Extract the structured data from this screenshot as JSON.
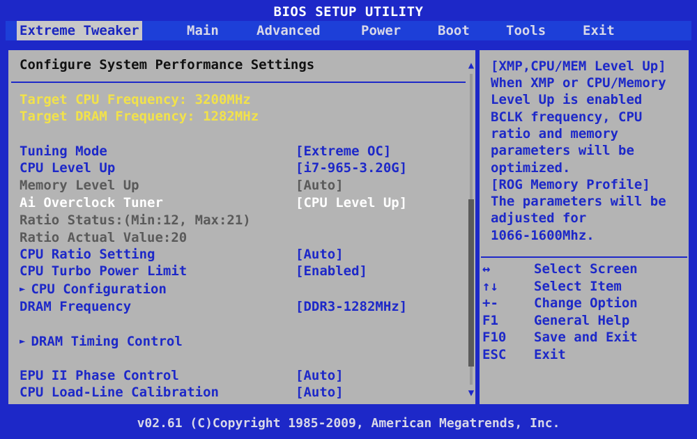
{
  "title": "BIOS SETUP UTILITY",
  "tabs": [
    {
      "label": "Extreme Tweaker",
      "active": true
    },
    {
      "label": "Main"
    },
    {
      "label": "Advanced"
    },
    {
      "label": "Power"
    },
    {
      "label": "Boot"
    },
    {
      "label": "Tools"
    },
    {
      "label": "Exit"
    }
  ],
  "main": {
    "section_title": "Configure System Performance Settings",
    "targets": [
      "Target CPU Frequency: 3200MHz",
      "Target DRAM Frequency: 1282MHz"
    ],
    "items": [
      {
        "label": "Tuning Mode",
        "value": "[Extreme OC]"
      },
      {
        "label": "CPU Level Up",
        "value": "[i7-965-3.20G]"
      },
      {
        "label": "Memory Level Up",
        "value": "[Auto]"
      },
      {
        "label": "Ai Overclock Tuner",
        "value": "[CPU Level Up]"
      },
      {
        "label": "Ratio Status:(Min:12, Max:21)",
        "value": ""
      },
      {
        "label": "Ratio Actual Value:20",
        "value": ""
      },
      {
        "label": "CPU Ratio Setting",
        "value": "[Auto]"
      },
      {
        "label": "CPU Turbo Power Limit",
        "value": "[Enabled]"
      },
      {
        "label": "CPU Configuration",
        "value": ""
      },
      {
        "label": "DRAM Frequency",
        "value": "[DDR3-1282MHz]"
      },
      {
        "label": "DRAM Timing Control",
        "value": ""
      },
      {
        "label": "EPU II Phase Control",
        "value": "[Auto]"
      },
      {
        "label": "CPU Load-Line Calibration",
        "value": "[Auto]"
      }
    ],
    "scroll_up_glyph": "▲",
    "scroll_down_glyph": "▼",
    "submenu_glyph": "►"
  },
  "help": {
    "lines": [
      "[XMP,CPU/MEM Level Up]",
      "When XMP or CPU/Memory",
      "Level Up is enabled",
      "BCLK frequency, CPU",
      "ratio and memory",
      "parameters will be",
      "optimized.",
      "[ROG Memory Profile]",
      "The parameters will be",
      "adjusted for",
      "1066-1600Mhz."
    ],
    "keys": [
      {
        "key": "↔",
        "desc": "Select Screen"
      },
      {
        "key": "↑↓",
        "desc": "Select Item"
      },
      {
        "key": "+-",
        "desc": "Change Option"
      },
      {
        "key": "F1",
        "desc": "General Help"
      },
      {
        "key": "F10",
        "desc": "Save and Exit"
      },
      {
        "key": "ESC",
        "desc": "Exit"
      }
    ]
  },
  "footer": "v02.61 (C)Copyright 1985-2009, American Megatrends, Inc.",
  "colors": {
    "background_blue": "#1d28c8",
    "panel_gray": "#b4b4b4",
    "highlight_yellow": "#f2e24a",
    "text_blue": "#1d28c8",
    "text_gray": "#5a5a5a",
    "selected_white": "#ffffff"
  }
}
